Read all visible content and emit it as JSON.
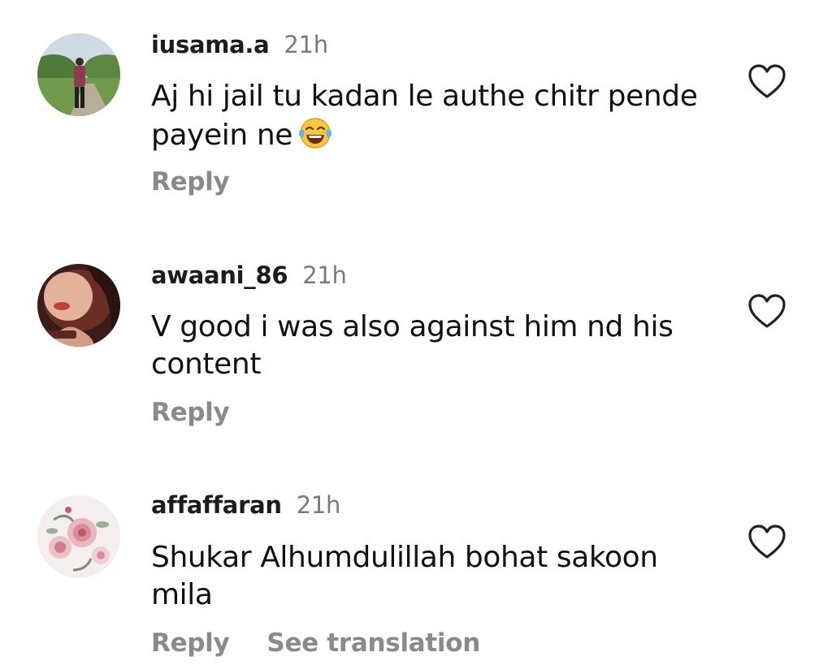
{
  "comments": [
    {
      "username": "iusama.a",
      "time": "21h",
      "text_lines": [
        "Aj hi jail tu kadan le authe chitr pende",
        "payein ne"
      ],
      "emoji": "face-with-tears-of-joy",
      "actions": [
        "Reply"
      ]
    },
    {
      "username": "awaani_86",
      "time": "21h",
      "text_lines": [
        "V good i was also against him nd his",
        "content"
      ],
      "actions": [
        "Reply"
      ]
    },
    {
      "username": "affaffaran",
      "time": "21h",
      "text_lines": [
        "Shukar Alhumdulillah bohat sakoon",
        "mila"
      ],
      "actions": [
        "Reply",
        "See translation"
      ]
    }
  ],
  "icons": {
    "like": "heart-outline-icon",
    "emoji": "face-with-tears-of-joy-emoji"
  },
  "colors": {
    "username": "#1c1c1c",
    "meta": "#7a7a7a",
    "action": "#8a8a8a",
    "heart_stroke": "#222222"
  }
}
